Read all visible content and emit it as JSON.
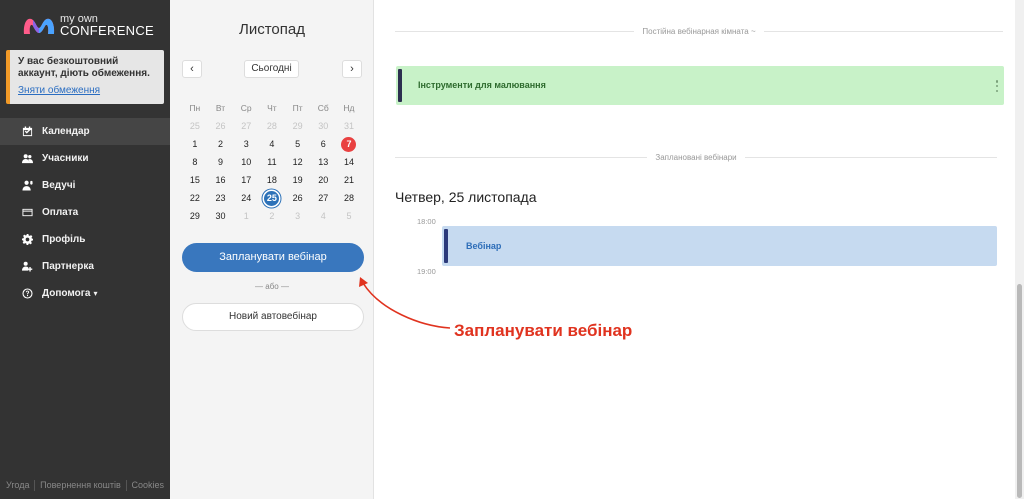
{
  "brand": {
    "line1": "my own",
    "line2": "CONFERENCE"
  },
  "notice": {
    "message": "У вас безкоштовний аккаунт, діють обмеження.",
    "link": "Зняти обмеження",
    "accent": "#f29a27"
  },
  "menu": [
    {
      "label": "Календар",
      "icon": "calendar-icon",
      "active": true
    },
    {
      "label": "Учасники",
      "icon": "users-icon"
    },
    {
      "label": "Ведучі",
      "icon": "presenter-icon"
    },
    {
      "label": "Оплата",
      "icon": "card-icon"
    },
    {
      "label": "Профіль",
      "icon": "gear-icon"
    },
    {
      "label": "Партнерка",
      "icon": "partner-icon"
    },
    {
      "label": "Допомога",
      "icon": "help-icon",
      "caret": "▾"
    }
  ],
  "footer": {
    "links": [
      "Угода",
      "Повернення коштів",
      "Cookies"
    ]
  },
  "calendar": {
    "month": "Листопад",
    "prev": "‹",
    "next": "›",
    "today_label": "Сьогодні",
    "weekdays": [
      "Пн",
      "Вт",
      "Ср",
      "Чт",
      "Пт",
      "Сб",
      "Нд"
    ],
    "weeks": [
      [
        {
          "d": "25",
          "m": true
        },
        {
          "d": "26",
          "m": true
        },
        {
          "d": "27",
          "m": true
        },
        {
          "d": "28",
          "m": true
        },
        {
          "d": "29",
          "m": true
        },
        {
          "d": "30",
          "m": true
        },
        {
          "d": "31",
          "m": true
        }
      ],
      [
        {
          "d": "1"
        },
        {
          "d": "2"
        },
        {
          "d": "3"
        },
        {
          "d": "4"
        },
        {
          "d": "5"
        },
        {
          "d": "6"
        },
        {
          "d": "7",
          "today": true
        }
      ],
      [
        {
          "d": "8"
        },
        {
          "d": "9"
        },
        {
          "d": "10"
        },
        {
          "d": "11"
        },
        {
          "d": "12"
        },
        {
          "d": "13"
        },
        {
          "d": "14"
        }
      ],
      [
        {
          "d": "15"
        },
        {
          "d": "16"
        },
        {
          "d": "17"
        },
        {
          "d": "18"
        },
        {
          "d": "19"
        },
        {
          "d": "20"
        },
        {
          "d": "21"
        }
      ],
      [
        {
          "d": "22"
        },
        {
          "d": "23"
        },
        {
          "d": "24"
        },
        {
          "d": "25",
          "selected": true
        },
        {
          "d": "26"
        },
        {
          "d": "27"
        },
        {
          "d": "28"
        }
      ],
      [
        {
          "d": "29"
        },
        {
          "d": "30"
        },
        {
          "d": "1",
          "m": true
        },
        {
          "d": "2",
          "m": true
        },
        {
          "d": "3",
          "m": true
        },
        {
          "d": "4",
          "m": true
        },
        {
          "d": "5",
          "m": true
        }
      ]
    ],
    "schedule_button": "Запланувати вебінар",
    "or_text": "— або —",
    "auto_button": "Новий автовебінар"
  },
  "main": {
    "permanent_divider": "Постійна вебінарная кімната ~",
    "room_title": "Інструменти для малювання",
    "scheduled_divider": "Заплановані вебінари",
    "day_title": "Четвер, 25 листопада",
    "times": [
      "18:00",
      "19:00"
    ],
    "event_title": "Вебінар"
  },
  "annotation": {
    "text": "Запланувати вебінар",
    "color": "#e0331f"
  },
  "colors": {
    "sidebar": "#333333",
    "primary": "#3977be",
    "room": "#c8f2c8",
    "event": "#c6daf0"
  }
}
